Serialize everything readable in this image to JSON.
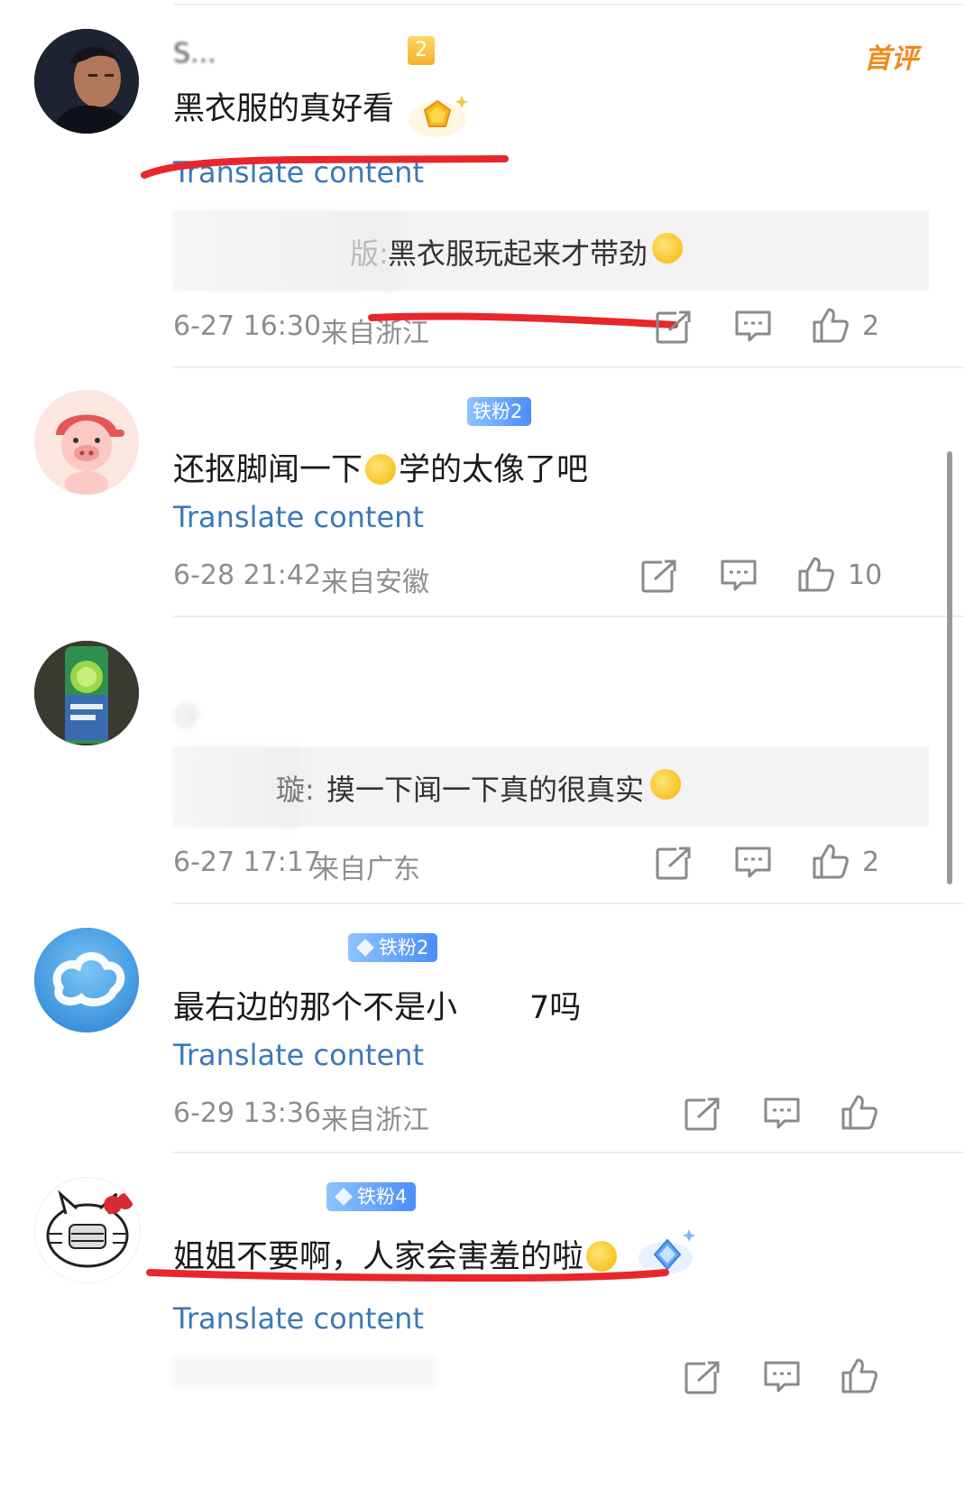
{
  "comments": [
    {
      "username": "S...",
      "badge": "2",
      "tag": "首评",
      "text": "黑衣服的真好看",
      "translate": "Translate content",
      "reply_prefix": "版:",
      "reply_text": "黑衣服玩起来才带劲",
      "date": "6-27 16:30",
      "location": "来自浙江",
      "likes": "2"
    },
    {
      "username": "",
      "badge": "铁粉2",
      "text_a": "还抠脚闻一下",
      "text_b": "学的太像了吧",
      "translate": "Translate content",
      "date": "6-28 21:42",
      "location": "来自安徽",
      "likes": "10"
    },
    {
      "username": "",
      "mention": "@",
      "reply_prefix": "璇:",
      "reply_text": "摸一下闻一下真的很真实",
      "date": "6-27 17:17",
      "location": "来自广东",
      "likes": "2"
    },
    {
      "username": "",
      "badge": "铁粉2",
      "text_a": "最右边的那个不是小",
      "text_b": "7吗",
      "translate": "Translate content",
      "date": "6-29 13:36",
      "location": "来自浙江",
      "likes": ""
    },
    {
      "username": "",
      "badge": "铁粉4",
      "text": "姐姐不要啊，人家会害羞的啦",
      "translate": "Translate content",
      "likes": ""
    }
  ],
  "colors": {
    "translate": "#3c78b8",
    "meta": "#8e8e8e",
    "annotation_red": "#e8262b",
    "first_comment_tag": "#f08a1d",
    "badge_blue": "#4b8ef7"
  },
  "icons": [
    "share-icon",
    "comment-icon",
    "thumbs-up-icon"
  ]
}
